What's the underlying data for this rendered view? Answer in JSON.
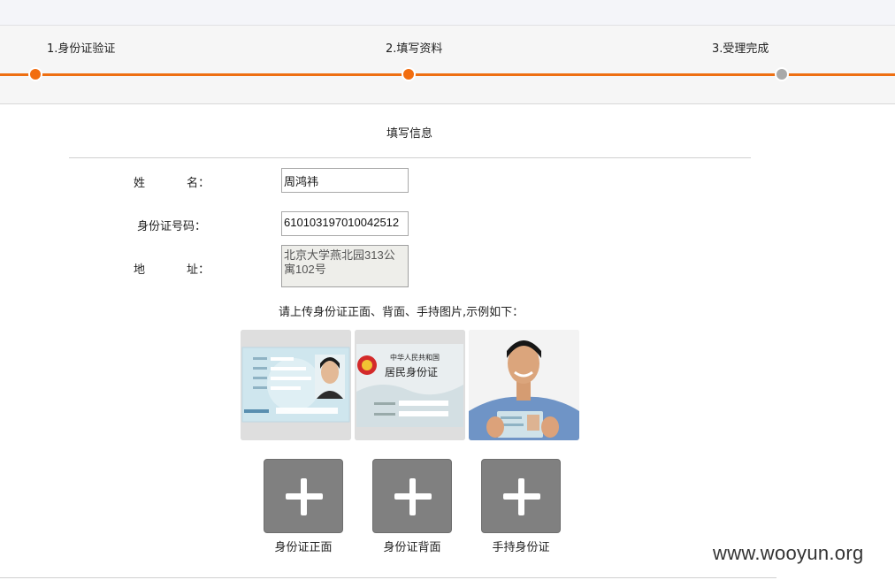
{
  "steps": [
    {
      "label": "1.身份证验证",
      "state": "active"
    },
    {
      "label": "2.填写资料",
      "state": "active"
    },
    {
      "label": "3.受理完成",
      "state": "inactive"
    }
  ],
  "section_title": "填写信息",
  "form": {
    "name_label": [
      "姓",
      "名："
    ],
    "name_value": "周鸿祎",
    "id_label": "身份证号码：",
    "id_value": "610103197010042512",
    "address_label": [
      "地",
      "址："
    ],
    "address_value": "北京大学燕北园313公寓102号"
  },
  "upload_hint": "请上传身份证正面、背面、手持图片,示例如下：",
  "samples": {
    "back_card_line1": "中华人民共和国",
    "back_card_line2": "居民身份证"
  },
  "uploads": [
    {
      "label": "身份证正面"
    },
    {
      "label": "身份证背面"
    },
    {
      "label": "手持身份证"
    }
  ],
  "watermark": "www.wooyun.org",
  "colors": {
    "accent": "#ee6f12",
    "inactive": "#a9a9a9",
    "upload_bg": "#808080"
  }
}
